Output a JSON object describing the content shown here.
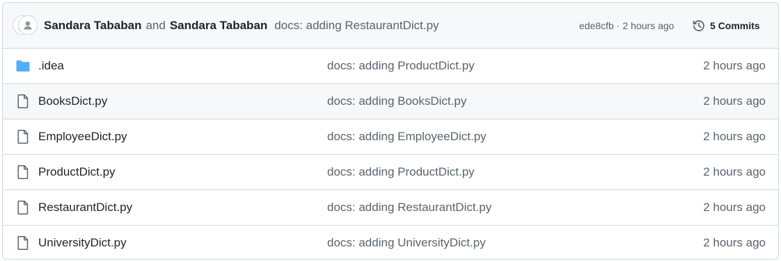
{
  "header": {
    "author1": "Sandara Tababan",
    "conjunction": "and",
    "author2": "Sandara Tababan",
    "message": "docs: adding RestaurantDict.py",
    "commit_hash": "ede8cfb",
    "separator": "·",
    "time": "2 hours ago",
    "commits_label": "5 Commits"
  },
  "colors": {
    "folder_icon": "#54aeff",
    "file_icon": "#59636e",
    "border": "#d0d7de",
    "header_bg": "#f6f8fa"
  },
  "files": [
    {
      "name": ".idea",
      "type": "folder",
      "icon": "folder-icon",
      "message": "docs: adding ProductDict.py",
      "age": "2 hours ago"
    },
    {
      "name": "BooksDict.py",
      "type": "file",
      "icon": "file-icon",
      "message": "docs: adding BooksDict.py",
      "age": "2 hours ago"
    },
    {
      "name": "EmployeeDict.py",
      "type": "file",
      "icon": "file-icon",
      "message": "docs: adding EmployeeDict.py",
      "age": "2 hours ago"
    },
    {
      "name": "ProductDict.py",
      "type": "file",
      "icon": "file-icon",
      "message": "docs: adding ProductDict.py",
      "age": "2 hours ago"
    },
    {
      "name": "RestaurantDict.py",
      "type": "file",
      "icon": "file-icon",
      "message": "docs: adding RestaurantDict.py",
      "age": "2 hours ago"
    },
    {
      "name": "UniversityDict.py",
      "type": "file",
      "icon": "file-icon",
      "message": "docs: adding UniversityDict.py",
      "age": "2 hours ago"
    }
  ]
}
